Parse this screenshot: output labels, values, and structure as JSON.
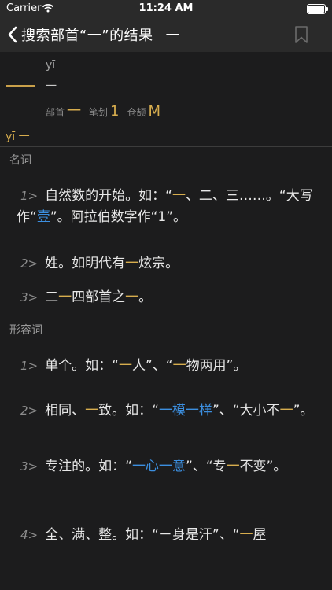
{
  "status_bar": {
    "carrier": "Carrier",
    "time": "11:24 AM"
  },
  "nav": {
    "back_label": "搜索部首“一”的结果",
    "title_char": "一"
  },
  "header": {
    "pinyin": "yī",
    "char": "一",
    "radical_label": "部首",
    "radical_value": "一",
    "strokes_label": "笔划",
    "strokes_value": "1",
    "cangjie_label": "仓颉",
    "cangjie_value": "M"
  },
  "headword": {
    "pinyin": "yī",
    "char": "一"
  },
  "sections": [
    {
      "pos": "名词",
      "entries": [
        {
          "num": "1>",
          "parts": [
            "自然数的开始。如：“",
            "一",
            "、二、三……。“大写作“",
            "壹",
            "”。阿拉伯数字作“1”。"
          ]
        },
        {
          "num": "2>",
          "parts": [
            "姓。如明代有",
            "一",
            "炫宗。"
          ]
        },
        {
          "num": "3>",
          "parts": [
            "二",
            "一",
            "四部首之",
            "一",
            "。"
          ]
        }
      ]
    },
    {
      "pos": "形容词",
      "entries": [
        {
          "num": "1>",
          "parts": [
            "单个。如：“",
            "一",
            "人”、“",
            "一",
            "物两用”。"
          ]
        },
        {
          "num": "2>",
          "parts": [
            "相同、",
            "一",
            "致。如：“",
            "一模一样",
            "”、“大小不",
            "一",
            "”。"
          ]
        },
        {
          "num": "3>",
          "parts": [
            "专注的。如：“",
            "一心一意",
            "”、“专",
            "一",
            "不变”。"
          ]
        },
        {
          "num": "4>",
          "parts": [
            "全、满、整。如：“－身是汗”、“",
            "一",
            "屋"
          ]
        }
      ]
    }
  ],
  "colors": {
    "background": "#1c1c1d",
    "bar": "#2a2a2a",
    "accent_gold": "#d7ad4e",
    "link_blue": "#3c8fe0"
  },
  "icons": [
    "wifi-icon",
    "battery-icon",
    "chevron-left-icon",
    "bookmark-icon"
  ]
}
